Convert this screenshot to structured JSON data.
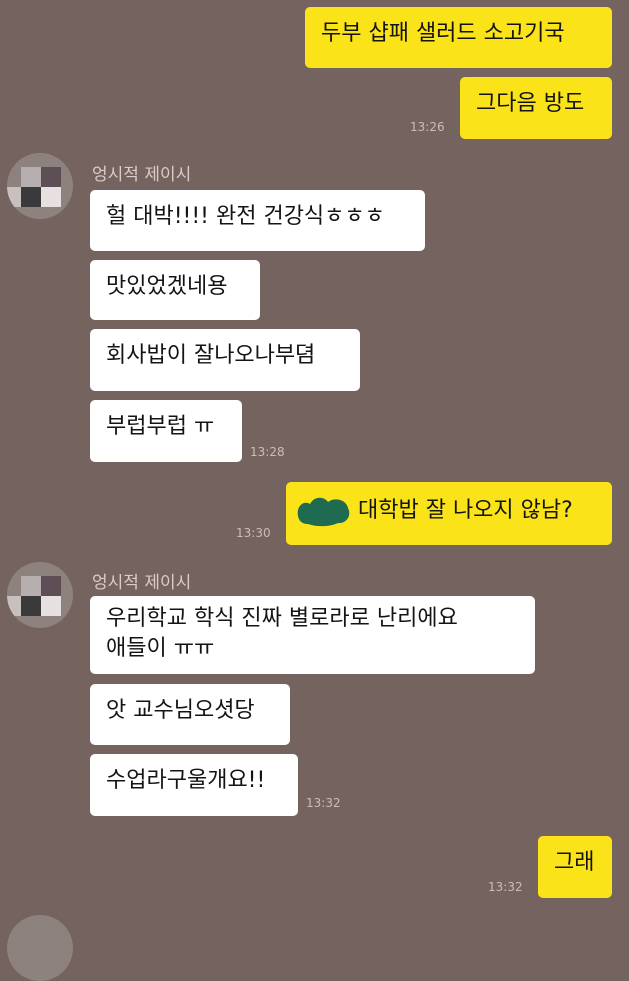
{
  "messages": {
    "m1": "두부 샵패 샐러드 소고기국",
    "m2": "그다음 방도",
    "t1": "13:26",
    "sender1": "엉시적 제이시",
    "m3": "헐 대박!!!! 완전 건강식ㅎㅎㅎ",
    "m4": "맛있었겠네용",
    "m5": "회사밥이 잘나오나부뎜",
    "m6": "부럽부럽 ㅠ",
    "t2": "13:28",
    "m7": "대학밥 잘 나오지 않남?",
    "t3": "13:30",
    "sender2": "엉시적 제이시",
    "m8a": "우리학교 학식 진짜 별로라로 난리에요",
    "m8b": "애들이 ㅠㅠ",
    "m9": "앗 교수님오셧당",
    "m10": "수업라구울개요!!",
    "t4": "13:32",
    "m11": "그래",
    "t5": "13:32"
  },
  "colors": {
    "background": "#75635f",
    "my_bubble": "#fbe319",
    "their_bubble": "#ffffff",
    "redaction": "#1e6b52"
  },
  "icons": {
    "avatar": "blurred-avatar",
    "redaction": "redaction-blob"
  }
}
